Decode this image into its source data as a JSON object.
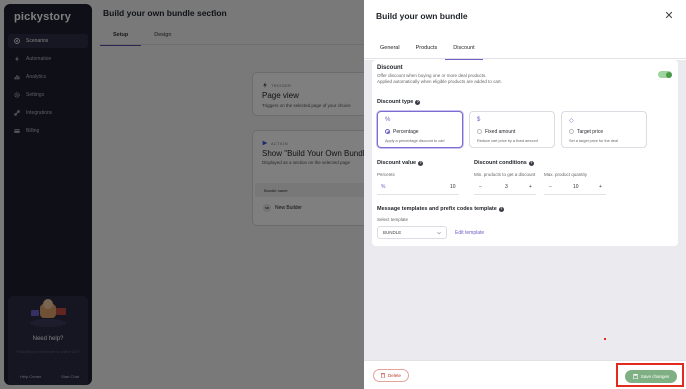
{
  "app": {
    "logo": "pickystory"
  },
  "sidebar": {
    "items": [
      {
        "label": "Scenarios",
        "icon": "scenarios-icon",
        "active": true
      },
      {
        "label": "Automation",
        "icon": "bolt-icon",
        "active": false
      },
      {
        "label": "Analytics",
        "icon": "chart-icon",
        "active": false
      },
      {
        "label": "Settings",
        "icon": "gear-icon",
        "active": false
      },
      {
        "label": "Integrations",
        "icon": "link-icon",
        "active": false
      },
      {
        "label": "Billing",
        "icon": "card-icon",
        "active": false
      }
    ],
    "promo": {
      "title": "Need help?",
      "text": "PickyStory's live team is online 24/7",
      "help_center": "Help Center",
      "start_chat": "Start Chat"
    }
  },
  "background": {
    "title": "Build your own bundle section",
    "tabs": [
      "Setup",
      "Design"
    ],
    "trigger_card": {
      "label": "TRIGGER",
      "heading": "Page view",
      "sub": "Triggers on the selected page of your choice"
    },
    "action_card": {
      "label": "ACTION",
      "heading": "Show \"Build Your Own Bundle\" section",
      "sub": "Displayed as a section on the selected page",
      "table_header": "Bundle name",
      "row_badge": "NB",
      "row_label": "New Builder"
    }
  },
  "drawer": {
    "title": "Build your own bundle",
    "tabs": [
      {
        "label": "General",
        "active": false
      },
      {
        "label": "Products",
        "active": false
      },
      {
        "label": "Discount",
        "active": true
      }
    ],
    "discount": {
      "title": "Discount",
      "desc_line1": "Offer discount when buying one or more deal products.",
      "desc_line2": "Applied automatically when eligible products are added to cart.",
      "enabled": true
    },
    "discount_type": {
      "title": "Discount type",
      "options": [
        {
          "icon": "%",
          "label": "Percentage",
          "desc": "Apply a percentage discount to cart",
          "selected": true
        },
        {
          "icon": "$",
          "label": "Fixed amount",
          "desc": "Reduce cart price by a fixed amount",
          "selected": false
        },
        {
          "icon": "◇",
          "label": "Target price",
          "desc": "Set a target price for the deal",
          "selected": false
        }
      ]
    },
    "discount_value": {
      "title": "Discount value",
      "field_label": "Percents",
      "prefix": "%",
      "value": "10"
    },
    "discount_conditions": {
      "title": "Discount conditions",
      "min_label": "Min. products to get a discount",
      "min_value": "3",
      "max_label": "Max. product quantity",
      "max_value": "10",
      "minus": "−",
      "plus": "+"
    },
    "templates": {
      "title": "Message templates and prefix codes template",
      "select_label": "Select template",
      "selected": "BUNDLE",
      "edit_link": "Edit template"
    },
    "footer": {
      "delete_label": "Delete",
      "save_label": "Save changes"
    }
  },
  "colors": {
    "accent": "#6c5fc7",
    "save": "#7fb083",
    "highlight": "#e22b1c",
    "sidebar_bg": "#1e1f2e"
  }
}
